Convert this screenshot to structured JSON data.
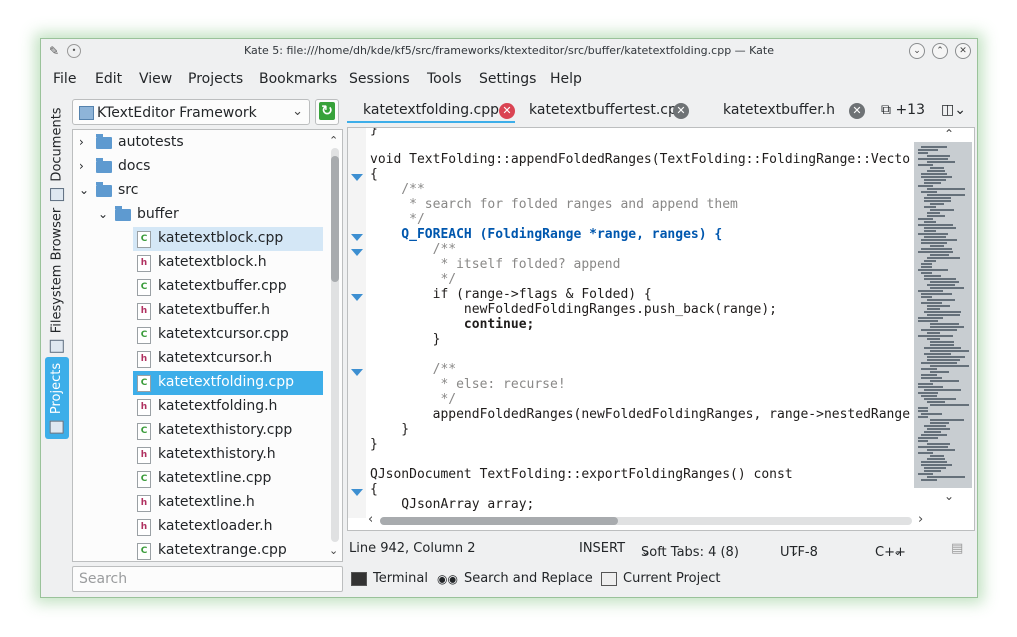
{
  "window": {
    "title": "Kate 5: file:///home/dh/kde/kf5/src/frameworks/ktexteditor/src/buffer/katetextfolding.cpp — Kate"
  },
  "menubar": [
    "File",
    "Edit",
    "View",
    "Projects",
    "Bookmarks",
    "Sessions",
    "Tools",
    "Settings",
    "Help"
  ],
  "left_tabs": {
    "documents": "Documents",
    "filesystem": "Filesystem Browser",
    "projects": "Projects"
  },
  "project_selector": "KTextEditor Framework",
  "tree": [
    {
      "label": "autotests",
      "type": "folder",
      "depth": 0,
      "expanded": false
    },
    {
      "label": "docs",
      "type": "folder",
      "depth": 0,
      "expanded": false
    },
    {
      "label": "src",
      "type": "folder",
      "depth": 0,
      "expanded": true
    },
    {
      "label": "buffer",
      "type": "folder",
      "depth": 1,
      "expanded": true
    },
    {
      "label": "katetextblock.cpp",
      "type": "cpp",
      "depth": 2,
      "state": "hover"
    },
    {
      "label": "katetextblock.h",
      "type": "h",
      "depth": 2
    },
    {
      "label": "katetextbuffer.cpp",
      "type": "cpp",
      "depth": 2
    },
    {
      "label": "katetextbuffer.h",
      "type": "h",
      "depth": 2
    },
    {
      "label": "katetextcursor.cpp",
      "type": "cpp",
      "depth": 2
    },
    {
      "label": "katetextcursor.h",
      "type": "h",
      "depth": 2
    },
    {
      "label": "katetextfolding.cpp",
      "type": "cpp",
      "depth": 2,
      "state": "selected"
    },
    {
      "label": "katetextfolding.h",
      "type": "h",
      "depth": 2
    },
    {
      "label": "katetexthistory.cpp",
      "type": "cpp",
      "depth": 2
    },
    {
      "label": "katetexthistory.h",
      "type": "h",
      "depth": 2
    },
    {
      "label": "katetextline.cpp",
      "type": "cpp",
      "depth": 2
    },
    {
      "label": "katetextline.h",
      "type": "h",
      "depth": 2
    },
    {
      "label": "katetextloader.h",
      "type": "h",
      "depth": 2
    },
    {
      "label": "katetextrange.cpp",
      "type": "cpp",
      "depth": 2
    }
  ],
  "search": {
    "placeholder": "Search"
  },
  "tabs": [
    {
      "label": "katetextfolding.cpp",
      "active": true
    },
    {
      "label": "katetextbuffertest.cpp",
      "active": false
    },
    {
      "label": "katetextbuffer.h",
      "active": false
    }
  ],
  "tabs_more": "+13",
  "code_lines": [
    "}",
    "",
    "void TextFolding::appendFoldedRanges(TextFolding::FoldingRange::Vecto",
    "{",
    "    /**",
    "     * search for folded ranges and append them",
    "     */",
    "    Q_FOREACH (FoldingRange *range, ranges) {",
    "        /**",
    "         * itself folded? append",
    "         */",
    "        if (range->flags & Folded) {",
    "            newFoldedFoldingRanges.push_back(range);",
    "            continue;",
    "        }",
    "",
    "        /**",
    "         * else: recurse!",
    "         */",
    "        appendFoldedRanges(newFoldedFoldingRanges, range->nestedRange",
    "    }",
    "}",
    "",
    "QJsonDocument TextFolding::exportFoldingRanges() const",
    "{",
    "    QJsonArray array;"
  ],
  "status": {
    "position": "Line 942, Column 2",
    "mode": "INSERT",
    "indent": "Soft Tabs: 4 (8)",
    "encoding": "UTF-8",
    "language": "C++"
  },
  "bottom_tools": {
    "terminal": "Terminal",
    "search_replace": "Search and Replace",
    "current_project": "Current Project"
  },
  "icons": {
    "window_menu": "kate-icon",
    "min": "minimize-icon",
    "max": "maximize-icon",
    "close": "close-icon"
  }
}
